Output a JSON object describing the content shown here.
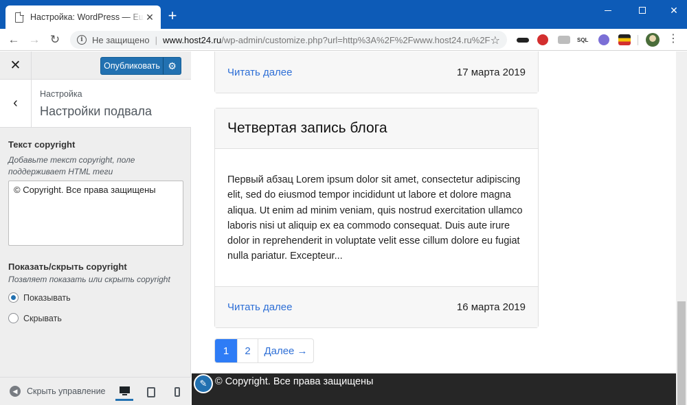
{
  "browser": {
    "tab_title": "Настройка: WordPress — Ещё один сайт на WordPress",
    "tab_close": "✕",
    "new_tab": "+",
    "url_security": "Не защищено",
    "url_host": "www.host24.ru",
    "url_path": "/wp-admin/customize.php?url=http%3A%2F%2Fwww.host24.ru%2F",
    "ext_sql": "SQL"
  },
  "customizer": {
    "publish_label": "Опубликовать",
    "breadcrumb": "Настройка",
    "section_title": "Настройки подвала",
    "copyright_label": "Текст copyright",
    "copyright_desc": "Добавьте текст copyright, поле поддерживает HTML теги",
    "copyright_value": "© Copyright. Все права защищены",
    "toggle_label": "Показать/скрыть copyright",
    "toggle_desc": "Позвляет показать или скрыть copyright",
    "options": [
      {
        "label": "Показывать",
        "checked": true
      },
      {
        "label": "Скрывать",
        "checked": false
      }
    ],
    "collapse_label": "Скрыть управление"
  },
  "preview": {
    "posts": [
      {
        "read_more": "Читать далее",
        "date": "17 марта 2019"
      },
      {
        "title": "Четвертая запись блога",
        "excerpt": "Первый абзац Lorem ipsum dolor sit amet, consectetur adipiscing elit, sed do eiusmod tempor incididunt ut labore et dolore magna aliqua. Ut enim ad minim veniam, quis nostrud exercitation ullamco laboris nisi ut aliquip ex ea commodo consequat. Duis aute irure dolor in reprehenderit in voluptate velit esse cillum dolore eu fugiat nulla pariatur. Excepteur...",
        "read_more": "Читать далее",
        "date": "16 марта 2019"
      }
    ],
    "pagination": [
      "1",
      "2",
      "Далее →"
    ],
    "footer_copyright": "© Copyright. Все права защищены"
  },
  "colors": {
    "titlebar": "#0d5bb7",
    "accent": "#2271b1",
    "link": "#2e6fd6",
    "footer_bg": "#262626"
  }
}
